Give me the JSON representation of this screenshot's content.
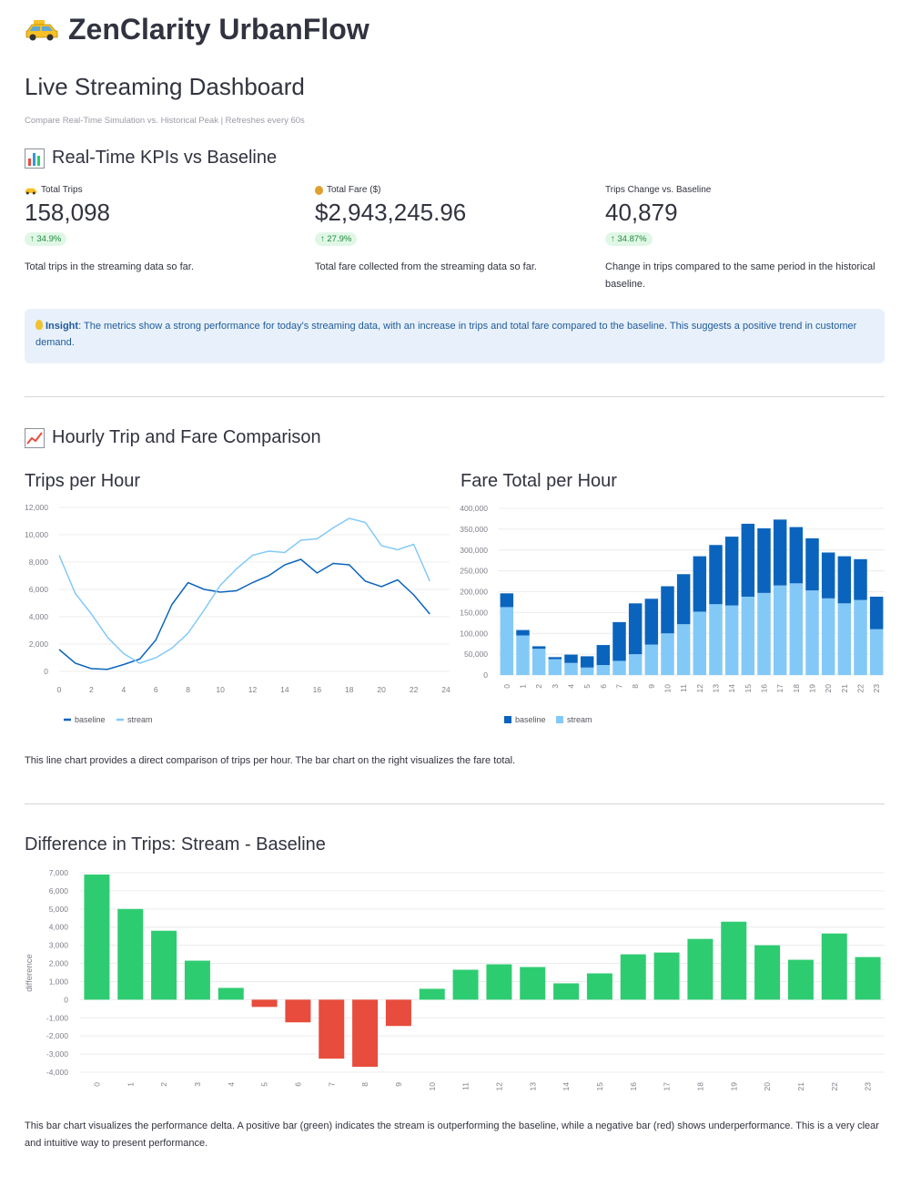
{
  "app": {
    "title": "ZenClarity UrbanFlow",
    "icon": "taxi-icon"
  },
  "page": {
    "heading": "Live Streaming Dashboard",
    "caption": "Compare Real-Time Simulation vs. Historical Peak | Refreshes every 60s"
  },
  "kpi_section": {
    "title": "Real-Time KPIs vs Baseline",
    "icon": "bar-chart-icon"
  },
  "metrics": [
    {
      "label": "Total Trips",
      "icon": "taxi-icon",
      "value": "158,098",
      "delta": "34.9%",
      "description": "Total trips in the streaming data so far."
    },
    {
      "label": "Total Fare ($)",
      "icon": "money-bag-icon",
      "value": "$2,943,245.96",
      "delta": "27.9%",
      "description": "Total fare collected from the streaming data so far."
    },
    {
      "label": "Trips Change vs. Baseline",
      "icon": "",
      "value": "40,879",
      "delta": "34.87%",
      "description": "Change in trips compared to the same period in the historical baseline."
    }
  ],
  "insight": {
    "label": "Insight",
    "text": ": The metrics show a strong performance for today's streaming data, with an increase in trips and total fare compared to the baseline. This suggests a positive trend in customer demand."
  },
  "hourly_section": {
    "title": "Hourly Trip and Fare Comparison",
    "icon": "line-chart-icon"
  },
  "charts_text": {
    "trips_title": "Trips per Hour",
    "fare_title": "Fare Total per Hour",
    "comparison_paragraph": "This line chart provides a direct comparison of trips per hour. The bar chart on the right visualizes the fare total.",
    "diff_title": "Difference in Trips: Stream - Baseline",
    "diff_paragraph": "This bar chart visualizes the performance delta. A positive bar (green) indicates the stream is outperforming the baseline, while a negative bar (red) shows underperformance. This is a very clear and intuitive way to present performance."
  },
  "colors": {
    "baseline": "#0a64bd",
    "stream": "#83c9f8",
    "positive": "#2ecc71",
    "negative": "#e74c3c"
  },
  "chart_data": [
    {
      "type": "line",
      "title": "Trips per Hour",
      "x": [
        0,
        1,
        2,
        3,
        4,
        5,
        6,
        7,
        8,
        9,
        10,
        11,
        12,
        13,
        14,
        15,
        16,
        17,
        18,
        19,
        20,
        21,
        22,
        23
      ],
      "series": [
        {
          "name": "baseline",
          "values": [
            1600,
            600,
            200,
            150,
            500,
            900,
            2300,
            4900,
            6500,
            6000,
            5800,
            5900,
            6500,
            7000,
            7800,
            8200,
            7200,
            7900,
            7800,
            6600,
            6200,
            6700,
            5600,
            4200
          ]
        },
        {
          "name": "stream",
          "values": [
            8500,
            5700,
            4200,
            2500,
            1300,
            600,
            1000,
            1700,
            2800,
            4500,
            6300,
            7500,
            8500,
            8800,
            8700,
            9600,
            9700,
            10500,
            11200,
            10900,
            9200,
            8900,
            9300,
            6600
          ]
        }
      ],
      "xticks": [
        "0",
        "2",
        "4",
        "6",
        "8",
        "10",
        "12",
        "14",
        "16",
        "18",
        "20",
        "22",
        "24"
      ],
      "yticks": [
        "0",
        "2,000",
        "4,000",
        "6,000",
        "8,000",
        "10,000",
        "12,000"
      ],
      "xlim": [
        0,
        24
      ],
      "ylim": [
        0,
        12000
      ],
      "legend": "bottom-left"
    },
    {
      "type": "bar",
      "title": "Fare Total per Hour",
      "categories": [
        "0",
        "1",
        "2",
        "3",
        "4",
        "5",
        "6",
        "7",
        "8",
        "9",
        "10",
        "11",
        "12",
        "13",
        "14",
        "15",
        "16",
        "17",
        "18",
        "19",
        "20",
        "21",
        "22",
        "23"
      ],
      "series": [
        {
          "name": "stream",
          "values": [
            163000,
            95000,
            63000,
            38000,
            29000,
            18000,
            24000,
            34000,
            50000,
            73000,
            100000,
            122000,
            152000,
            170000,
            167000,
            188000,
            197000,
            215000,
            220000,
            203000,
            184000,
            172000,
            180000,
            110000
          ]
        },
        {
          "name": "baseline",
          "values": [
            33000,
            13000,
            6000,
            5000,
            20000,
            27000,
            48000,
            93000,
            122000,
            110000,
            113000,
            120000,
            133000,
            142000,
            165000,
            175000,
            155000,
            158000,
            135000,
            125000,
            110000,
            113000,
            98000,
            78000
          ]
        }
      ],
      "stacked": true,
      "yticks": [
        "0",
        "50,000",
        "100,000",
        "150,000",
        "200,000",
        "250,000",
        "300,000",
        "350,000",
        "400,000"
      ],
      "ylim": [
        0,
        400000
      ],
      "legend": "bottom-left",
      "legend_order": [
        "baseline",
        "stream"
      ]
    },
    {
      "type": "bar",
      "title": "Difference in Trips: Stream - Baseline",
      "ylabel": "difference",
      "categories": [
        "0",
        "1",
        "2",
        "3",
        "4",
        "5",
        "6",
        "7",
        "8",
        "9",
        "10",
        "11",
        "12",
        "13",
        "14",
        "15",
        "16",
        "17",
        "18",
        "19",
        "20",
        "21",
        "22",
        "23"
      ],
      "values": [
        6900,
        5000,
        3800,
        2150,
        650,
        -400,
        -1250,
        -3250,
        -3700,
        -1450,
        600,
        1650,
        1950,
        1800,
        900,
        1450,
        2500,
        2600,
        3350,
        4300,
        3000,
        2200,
        3650,
        2350
      ],
      "yticks": [
        "-4,000",
        "-3,000",
        "-2,000",
        "-1,000",
        "0",
        "1,000",
        "2,000",
        "3,000",
        "4,000",
        "5,000",
        "6,000",
        "7,000"
      ],
      "ylim": [
        -4000,
        7000
      ]
    }
  ]
}
